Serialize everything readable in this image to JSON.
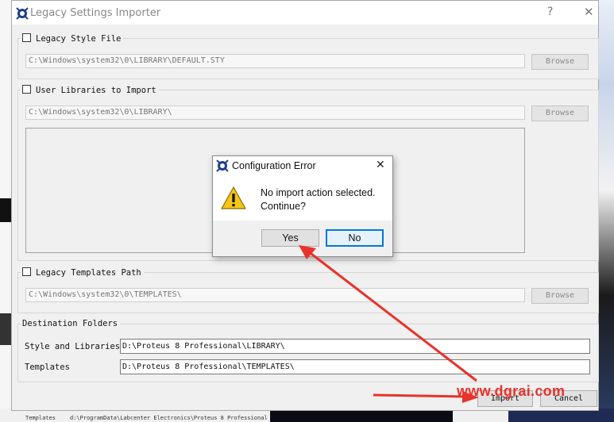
{
  "window": {
    "title": "Legacy Settings Importer",
    "help_glyph": "?",
    "close_glyph": "✕"
  },
  "legacy_style": {
    "label": "Legacy Style File",
    "checked": false,
    "path": "C:\\Windows\\system32\\0\\LIBRARY\\DEFAULT.STY",
    "browse_label": "Browse"
  },
  "user_libraries": {
    "label": "User Libraries to Import",
    "checked": false,
    "path": "C:\\Windows\\system32\\0\\LIBRARY\\",
    "browse_label": "Browse"
  },
  "legacy_templates": {
    "label": "Legacy Templates Path",
    "checked": false,
    "path": "C:\\Windows\\system32\\0\\TEMPLATES\\",
    "browse_label": "Browse"
  },
  "destination": {
    "label": "Destination Folders",
    "style_label": "Style and Libraries",
    "style_value": "D:\\Proteus 8 Professional\\LIBRARY\\",
    "templates_label": "Templates",
    "templates_value": "D:\\Proteus 8 Professional\\TEMPLATES\\"
  },
  "actions": {
    "import_label": "Import",
    "cancel_label": "Cancel"
  },
  "dialog": {
    "title": "Configuration Error",
    "close_glyph": "✕",
    "message_line1": "No import action selected.",
    "message_line2": "Continue?",
    "yes_label": "Yes",
    "no_label": "No"
  },
  "background": {
    "bottom_text_1": "Templates",
    "bottom_text_2": "d:\\ProgramData\\Labcenter Electronics\\Proteus 8 Professional"
  },
  "watermark": "www.dgrai.com",
  "colors": {
    "annotation_arrow": "#e8322b",
    "dialog_default_border": "#0078d7"
  }
}
